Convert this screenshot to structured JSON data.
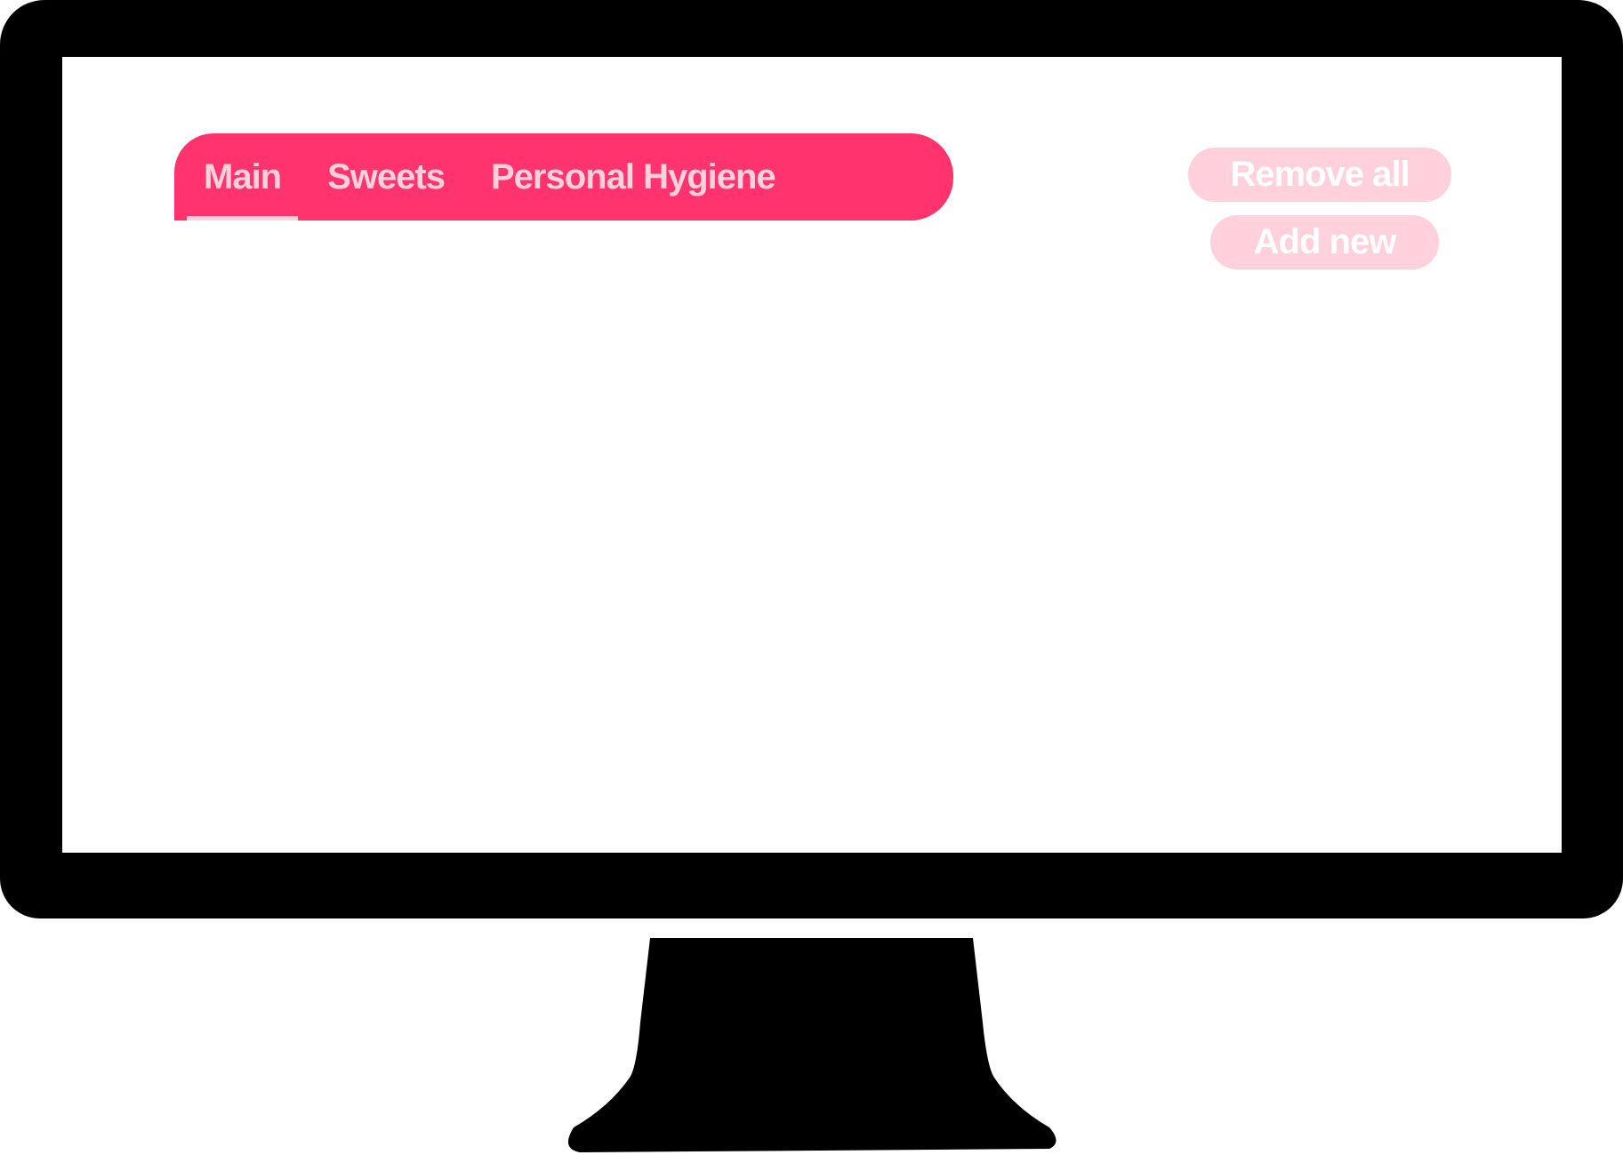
{
  "tabs": [
    {
      "label": "Main",
      "active": true
    },
    {
      "label": "Sweets",
      "active": false
    },
    {
      "label": "Personal Hygiene",
      "active": false
    }
  ],
  "actions": {
    "remove_all_label": "Remove all",
    "add_new_label": "Add new"
  },
  "colors": {
    "tab_bar": "#ff336d",
    "tab_text": "#ffd1dc",
    "button_bg": "#ffd1dc",
    "button_text": "#ffffff",
    "monitor": "#000000"
  }
}
